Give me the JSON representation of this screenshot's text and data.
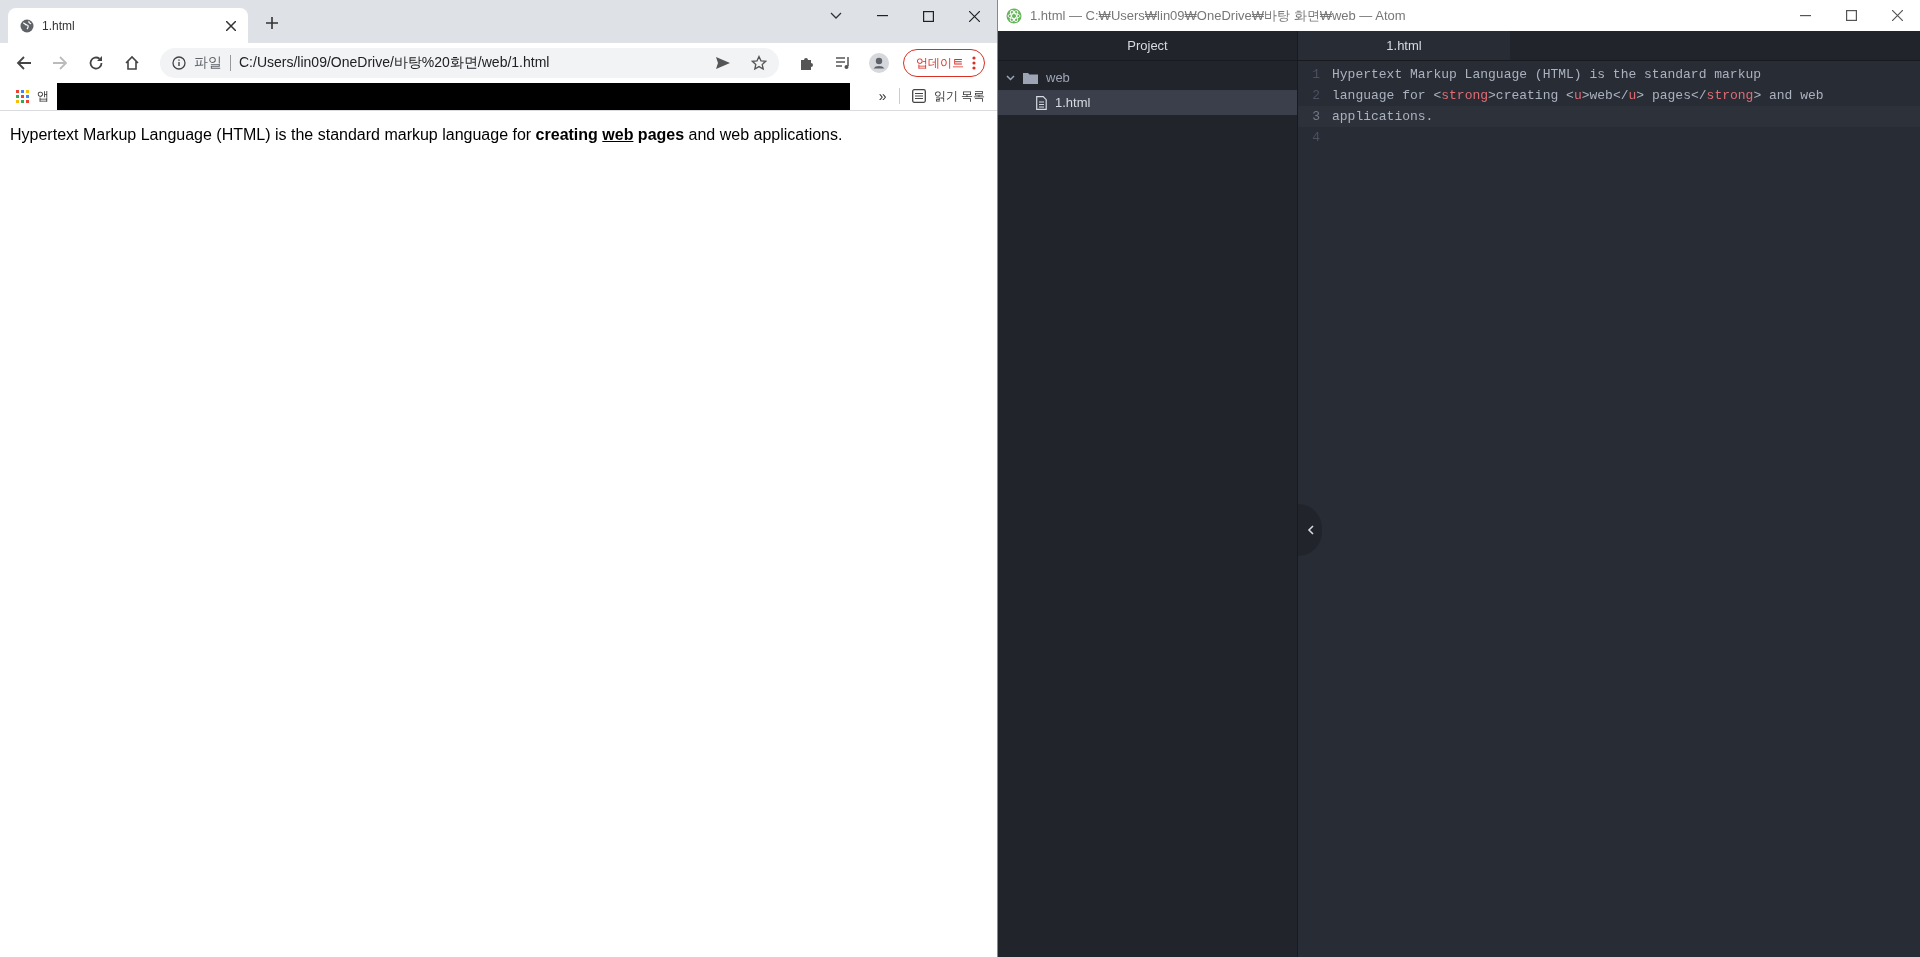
{
  "browser": {
    "tabs": [
      {
        "title": "1.html",
        "selected": true
      }
    ],
    "address_bar": {
      "scheme_label": "파일",
      "url": "C:/Users/lin09/OneDrive/바탕%20화면/web/1.html"
    },
    "update_button": "업데이트",
    "bookmarks_bar": {
      "apps_label": "앱",
      "overflow": "»",
      "reading_list": "읽기 목록"
    },
    "page": {
      "paragraph": [
        {
          "text": "Hypertext Markup Language (HTML) is the standard markup language for ",
          "kind": "plain"
        },
        {
          "text": "creating ",
          "kind": "strong"
        },
        {
          "text": "web",
          "kind": "strong_underlined"
        },
        {
          "text": " pages",
          "kind": "strong"
        },
        {
          "text": " and web applications.",
          "kind": "plain"
        }
      ]
    }
  },
  "atom": {
    "window_title": "1.html — C:₩Users₩lin09₩OneDrive₩바탕 화면₩web — Atom",
    "sidebar": {
      "header": "Project",
      "tree": [
        {
          "name": "web",
          "kind": "folder",
          "expanded": true,
          "selected": false,
          "children": [
            {
              "name": "1.html",
              "kind": "file",
              "selected": true
            }
          ]
        }
      ]
    },
    "tabs": [
      {
        "label": "1.html",
        "selected": true
      }
    ],
    "editor": {
      "lines": [
        {
          "number": "1",
          "current": false,
          "tokens": [
            {
              "text": "Hypertext Markup Language (HTML) is the standard markup",
              "kind": "text"
            }
          ]
        },
        {
          "number": "2",
          "current": false,
          "tokens": [
            {
              "text": "language for ",
              "kind": "text"
            },
            {
              "text": "<",
              "kind": "punct"
            },
            {
              "text": "strong",
              "kind": "tag"
            },
            {
              "text": ">",
              "kind": "punct"
            },
            {
              "text": "creating ",
              "kind": "text"
            },
            {
              "text": "<",
              "kind": "punct"
            },
            {
              "text": "u",
              "kind": "tag"
            },
            {
              "text": ">",
              "kind": "punct"
            },
            {
              "text": "web",
              "kind": "text"
            },
            {
              "text": "</",
              "kind": "punct"
            },
            {
              "text": "u",
              "kind": "tag"
            },
            {
              "text": ">",
              "kind": "punct"
            },
            {
              "text": " pages",
              "kind": "text"
            },
            {
              "text": "</",
              "kind": "punct"
            },
            {
              "text": "strong",
              "kind": "tag"
            },
            {
              "text": ">",
              "kind": "punct"
            },
            {
              "text": " and web",
              "kind": "text"
            }
          ]
        },
        {
          "number": "3",
          "current": true,
          "tokens": [
            {
              "text": "applications.",
              "kind": "text"
            }
          ]
        },
        {
          "number": "4",
          "current": false
        }
      ]
    }
  }
}
